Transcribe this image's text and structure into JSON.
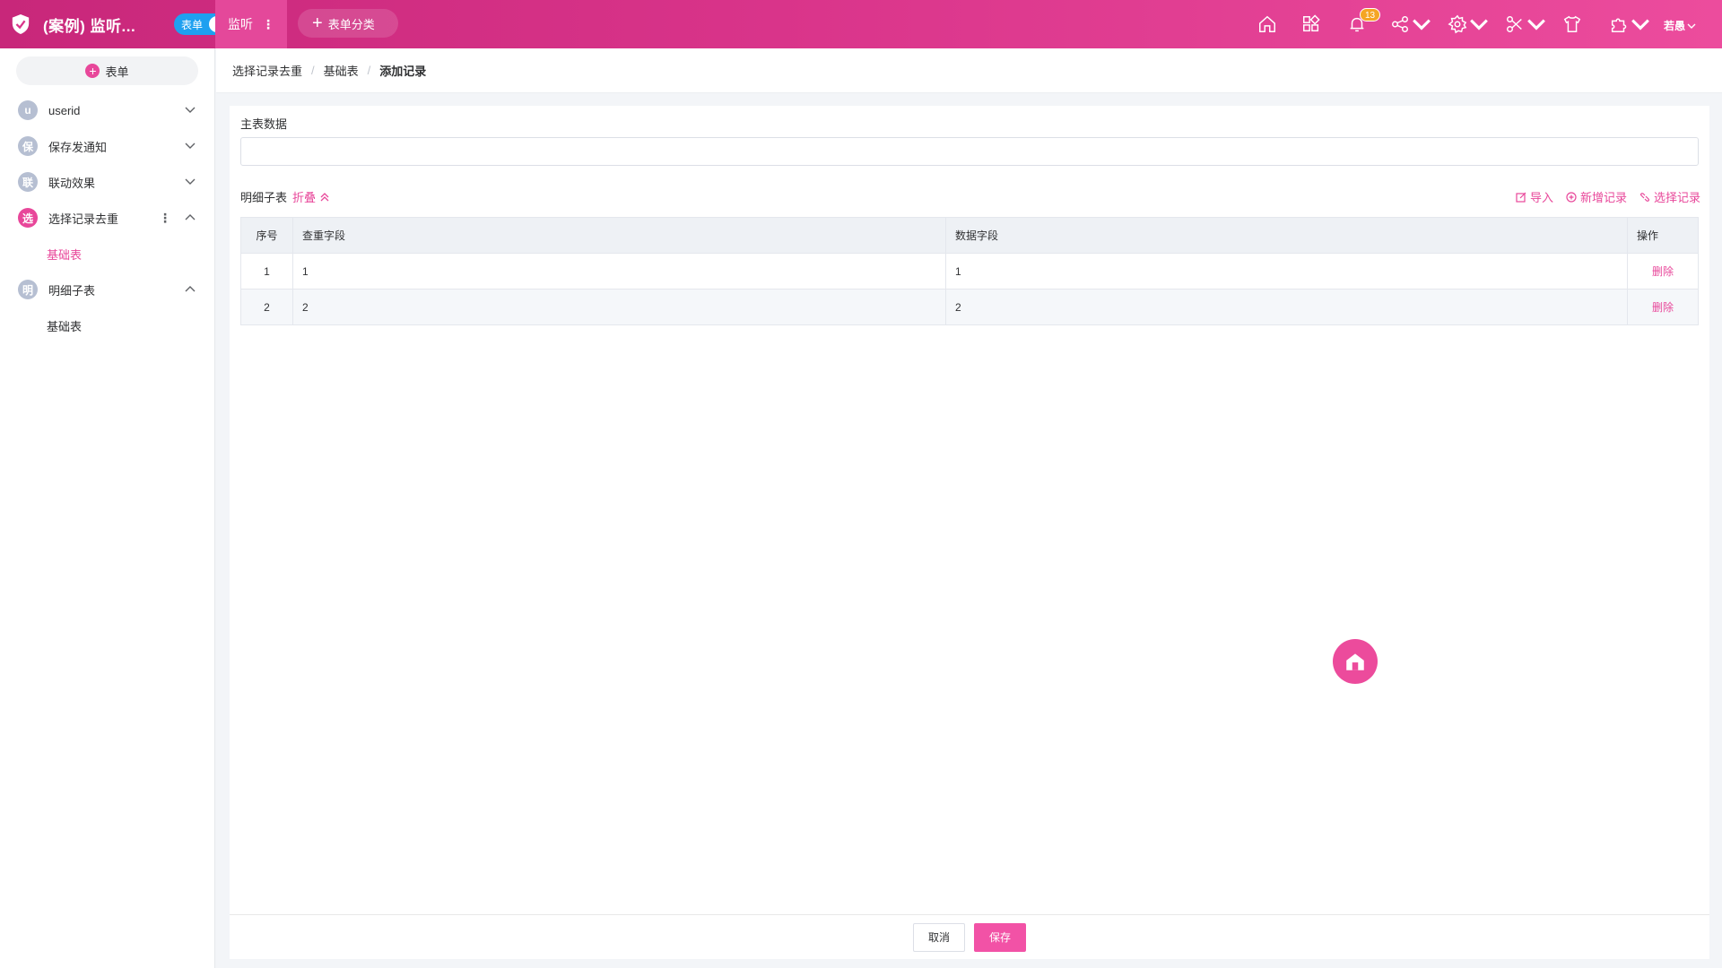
{
  "header": {
    "app_title": "(案例) 监听...",
    "toggle_label": "表单",
    "active_tab": "监听",
    "add_category": "表单分类",
    "notification_count": "13",
    "user_name": "若愚"
  },
  "sidebar": {
    "add_label": "表单",
    "items": [
      {
        "avatar": "u",
        "label": "userid"
      },
      {
        "avatar": "保",
        "label": "保存发通知"
      },
      {
        "avatar": "联",
        "label": "联动效果"
      },
      {
        "avatar": "选",
        "label": "选择记录去重"
      },
      {
        "sub": "基础表"
      },
      {
        "avatar": "明",
        "label": "明细子表"
      },
      {
        "sub": "基础表"
      }
    ]
  },
  "breadcrumb": [
    "选择记录去重",
    "基础表",
    "添加记录"
  ],
  "form": {
    "main_section_label": "主表数据",
    "main_input_value": "",
    "sub_section_label": "明细子表",
    "collapse_label": "折叠",
    "actions": {
      "import": "导入",
      "add": "新增记录",
      "select": "选择记录"
    },
    "table": {
      "headers": [
        "序号",
        "查重字段",
        "数据字段",
        "操作"
      ],
      "rows": [
        {
          "idx": "1",
          "dup": "1",
          "data": "1",
          "op": "删除"
        },
        {
          "idx": "2",
          "dup": "2",
          "data": "2",
          "op": "删除"
        }
      ]
    }
  },
  "footer": {
    "cancel": "取消",
    "save": "保存"
  },
  "colors": {
    "accent": "#e8479a",
    "topbar_start": "#c8277a",
    "topbar_end": "#ec4c9d",
    "toggle": "#1ea0f0"
  }
}
